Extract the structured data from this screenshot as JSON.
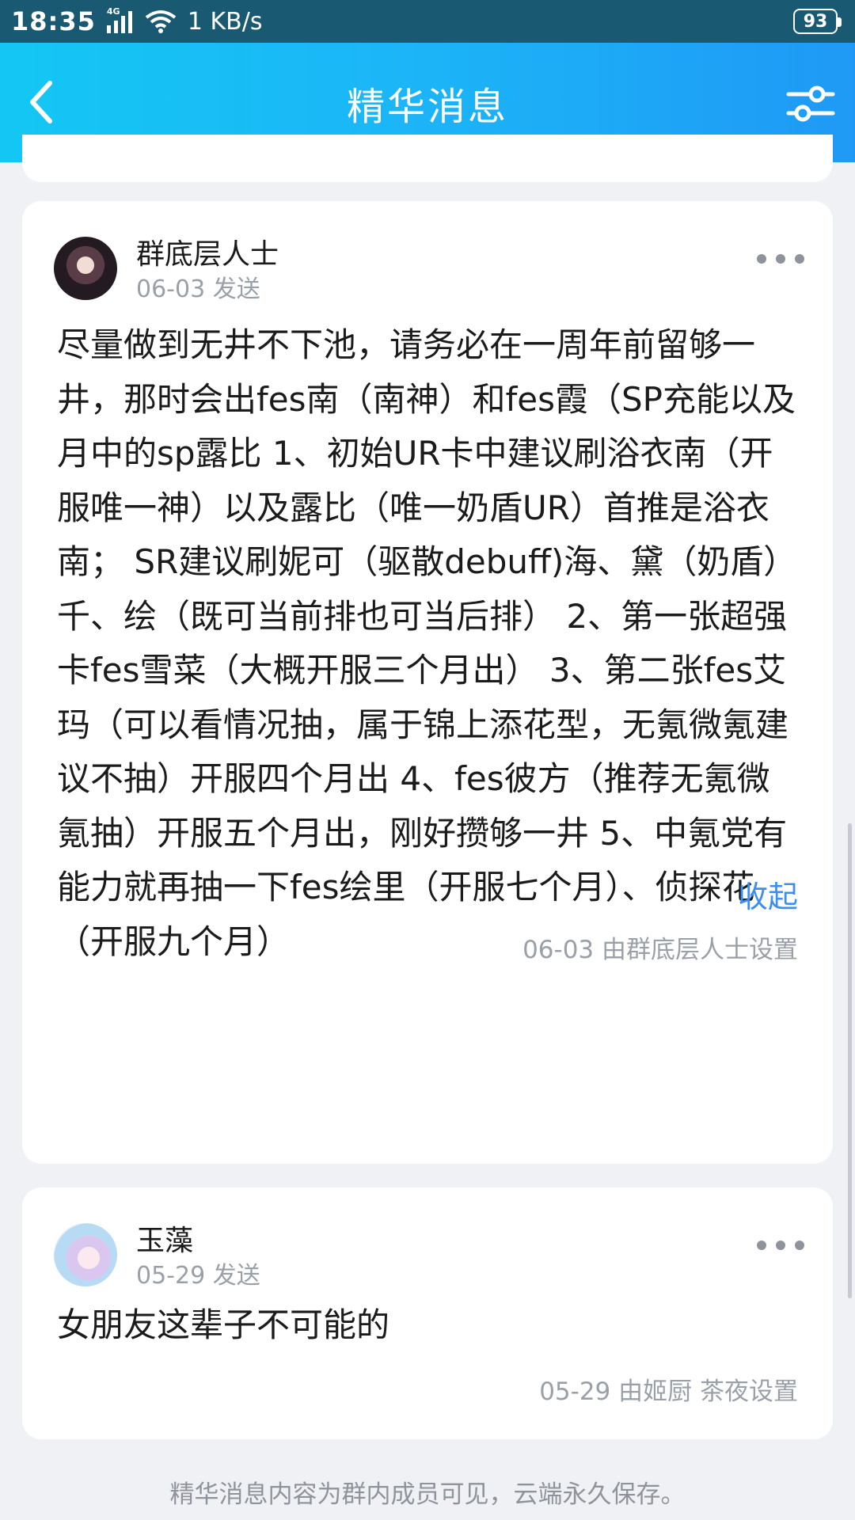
{
  "status_bar": {
    "time": "18:35",
    "network": "4G",
    "speed": "1 KB/s",
    "battery": "93"
  },
  "nav": {
    "title": "精华消息",
    "back_icon": "chevron-left-icon",
    "settings_icon": "sliders-icon"
  },
  "messages": [
    {
      "author": "群底层人士",
      "time": "06-03 发送",
      "text": "尽量做到无井不下池，请务必在一周年前留够一井，那时会出fes南（南神）和fes霞（SP充能以及月中的sp露比 1、初始UR卡中建议刷浴衣南（开服唯一神）以及露比（唯一奶盾UR）首推是浴衣南； SR建议刷妮可（驱散debuff)海、黛（奶盾）千、绘（既可当前排也可当后排） 2、第一张超强卡fes雪菜（大概开服三个月出） 3、第二张fes艾玛（可以看情况抽，属于锦上添花型，无氪微氪建议不抽）开服四个月出 4、fes彼方（推荐无氪微氪抽）开服五个月出，刚好攒够一井 5、中氪党有能力就再抽一下fes绘里（开服七个月）、侦探花（开服九个月）",
      "collapse_label": "收起",
      "set_info": "06-03 由群底层人士设置"
    },
    {
      "author": "玉藻",
      "time": "05-29 发送",
      "text": "女朋友这辈子不可能的",
      "set_info": "05-29 由姬厨 茶夜设置"
    }
  ],
  "footer": {
    "note": "精华消息内容为群内成员可见，云端永久保存。"
  }
}
